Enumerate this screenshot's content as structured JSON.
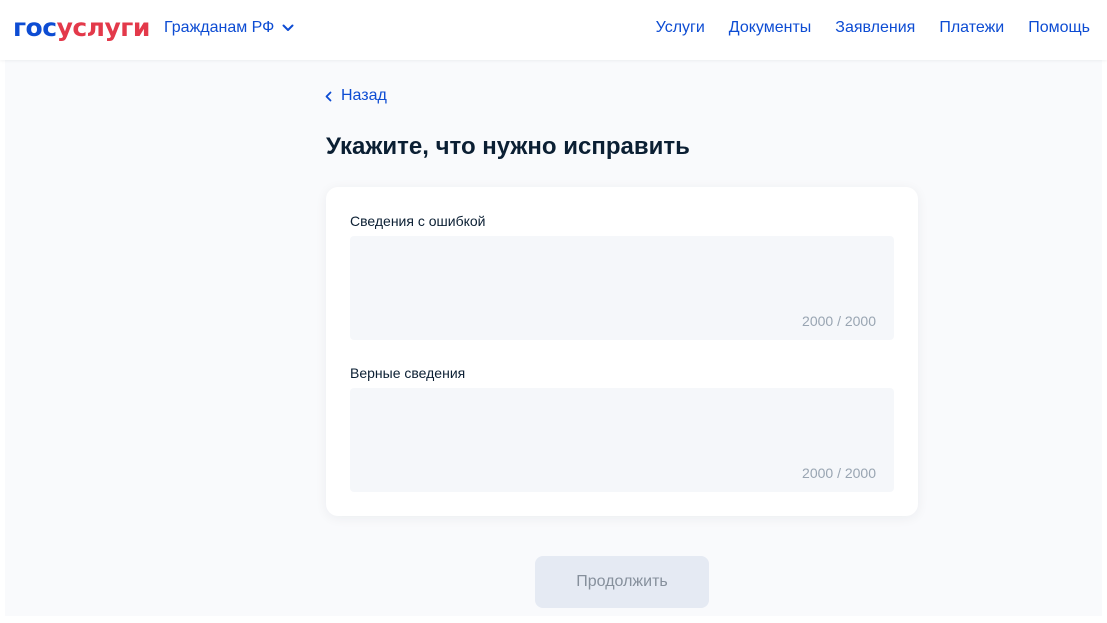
{
  "header": {
    "logo_part_a": "гос",
    "logo_part_b": "услуги",
    "citizen_select": "Гражданам РФ",
    "nav": [
      "Услуги",
      "Документы",
      "Заявления",
      "Платежи",
      "Помощь"
    ]
  },
  "main": {
    "back_label": "Назад",
    "title": "Укажите, что нужно исправить",
    "fields": [
      {
        "label": "Сведения с ошибкой",
        "value": "",
        "counter": "2000 / 2000"
      },
      {
        "label": "Верные сведения",
        "value": "",
        "counter": "2000 / 2000"
      }
    ],
    "continue_label": "Продолжить",
    "continue_disabled": true
  },
  "colors": {
    "brand_blue": "#0d4cd3",
    "brand_red": "#e3394a",
    "text": "#0b1f33",
    "page_bg": "#f9fafc",
    "field_bg": "#f5f7fa",
    "counter_text": "#99a5b2",
    "button_disabled_bg": "#e5eaf3",
    "button_disabled_text": "#86909c"
  },
  "icons": {
    "citizen_select": "chevron-down-icon",
    "back": "chevron-left-icon"
  }
}
